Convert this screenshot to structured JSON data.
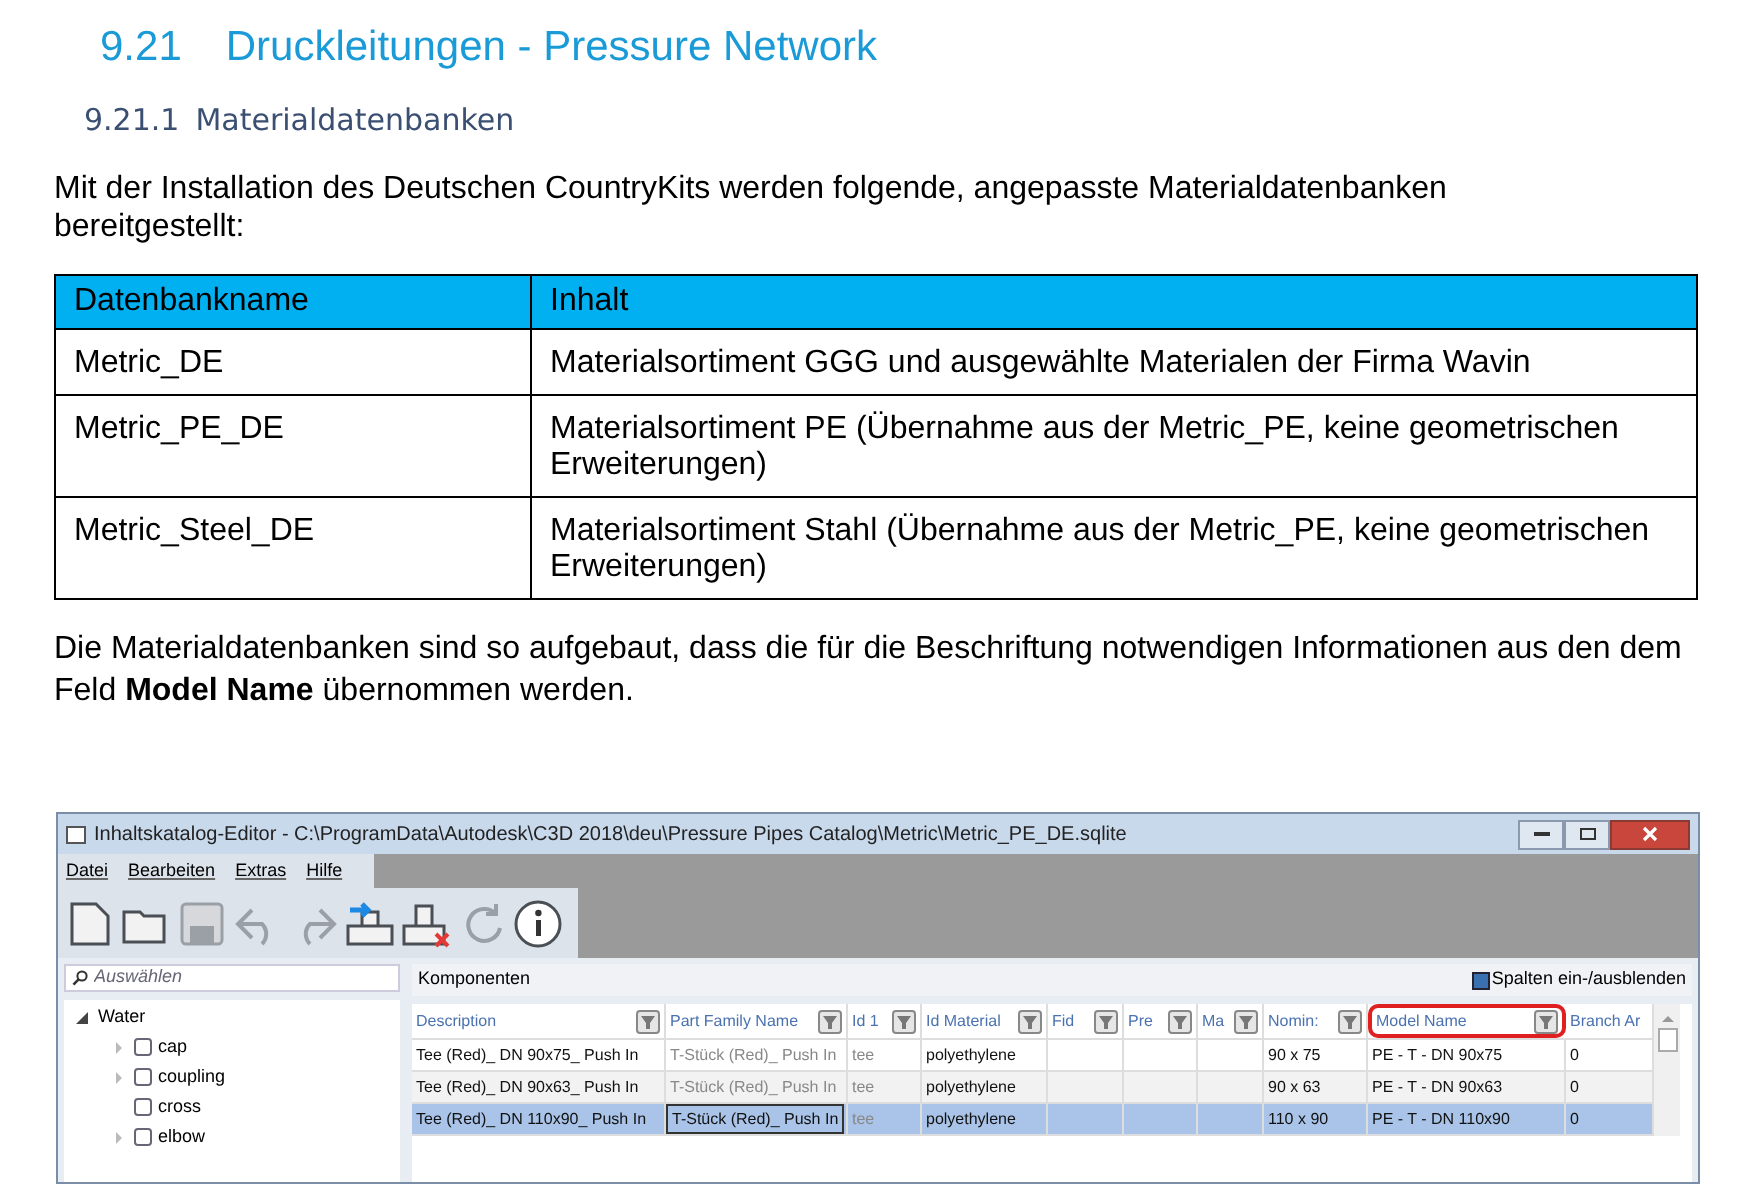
{
  "heading": {
    "number": "9.21",
    "title": "Druckleitungen - Pressure Network"
  },
  "subheading": {
    "number": "9.21.1",
    "title": "Materialdatenbanken"
  },
  "intro": "Mit der Installation des Deutschen CountryKits werden folgende, angepasste Materialdatenbanken bereitgestellt:",
  "table": {
    "columns": [
      "Datenbankname",
      "Inhalt"
    ],
    "rows": [
      [
        "Metric_DE",
        "Materialsortiment GGG und ausgewählte Materialen der Firma Wavin"
      ],
      [
        "Metric_PE_DE",
        "Materialsortiment PE (Übernahme aus der Metric_PE, keine geometrischen Erweiterungen)"
      ],
      [
        "Metric_Steel_DE",
        "Materialsortiment Stahl (Übernahme aus der Metric_PE, keine geometrischen Erweiterungen)"
      ]
    ]
  },
  "note": "Die Materialdatenbanken sind so aufgebaut, dass die für die Beschriftung notwendigen Informationen aus den dem Feld **Model Name** übernommen werden.",
  "app_window": {
    "title": "Inhaltskatalog-Editor - C:\\ProgramData\\Autodesk\\C3D 2018\\deu\\Pressure Pipes Catalog\\Metric\\Metric_PE_DE.sqlite",
    "menu": [
      "Datei",
      "Bearbeiten",
      "Extras",
      "Hilfe"
    ],
    "toolbar": [
      {
        "kind": "new",
        "disabled": false
      },
      {
        "kind": "open",
        "disabled": false
      },
      {
        "kind": "save",
        "disabled": true
      },
      {
        "kind": "undo",
        "disabled": true
      },
      {
        "kind": "redo",
        "disabled": true
      },
      {
        "kind": "add_part",
        "disabled": false
      },
      {
        "kind": "delete_part",
        "disabled": false
      },
      {
        "kind": "refresh",
        "disabled": true
      },
      {
        "kind": "info",
        "disabled": false
      }
    ],
    "search": {
      "placeholder": "Auswählen"
    },
    "tree": [
      {
        "label": "Water",
        "expanded": true,
        "children": [
          {
            "label": "cap",
            "expandable": true,
            "checked": false
          },
          {
            "label": "coupling",
            "expandable": true,
            "checked": false
          },
          {
            "label": "cross",
            "expandable": false,
            "checked": false
          },
          {
            "label": "elbow",
            "expandable": true,
            "checked": false
          }
        ]
      }
    ],
    "panel_title": "Komponenten",
    "columns_toggle": "Spalten ein-/ausblenden",
    "grid": {
      "columns": [
        {
          "label": "Description",
          "muted": false,
          "highlighted": false
        },
        {
          "label": "Part Family Name",
          "muted": true,
          "highlighted": false
        },
        {
          "label": "Id 1",
          "muted": true,
          "highlighted": false
        },
        {
          "label": "Id Material",
          "muted": false,
          "highlighted": false
        },
        {
          "label": "Fid",
          "highlighted": false
        },
        {
          "label": "Pre",
          "highlighted": false
        },
        {
          "label": "Ma",
          "highlighted": false
        },
        {
          "label": "Nomin:",
          "muted": false,
          "highlighted": false
        },
        {
          "label": "Model Name",
          "muted": false,
          "highlighted": true
        },
        {
          "label": "Branch Ar",
          "muted": false,
          "highlighted": false,
          "filter": false
        }
      ],
      "rows": [
        {
          "selected": false,
          "cells": [
            {
              "text": "Tee (Red)_ DN 90x75_ Push In",
              "focused": false
            },
            {
              "text": "T-Stück (Red)_ Push In",
              "focused": false
            },
            {
              "text": "tee",
              "focused": false
            },
            {
              "text": "polyethylene",
              "focused": false
            },
            null,
            null,
            null,
            {
              "text": "90 x 75",
              "focused": false
            },
            {
              "text": "PE - T - DN 90x75",
              "focused": false
            },
            {
              "text": "0",
              "focused": false
            }
          ]
        },
        {
          "selected": false,
          "cells": [
            {
              "text": "Tee (Red)_ DN 90x63_ Push In",
              "focused": false
            },
            {
              "text": "T-Stück (Red)_ Push In",
              "focused": false
            },
            {
              "text": "tee",
              "focused": false
            },
            {
              "text": "polyethylene",
              "focused": false
            },
            null,
            null,
            null,
            {
              "text": "90 x 63",
              "focused": false
            },
            {
              "text": "PE - T - DN 90x63",
              "focused": false
            },
            {
              "text": "0",
              "focused": false
            }
          ]
        },
        {
          "selected": true,
          "cells": [
            {
              "text": "Tee (Red)_ DN 110x90_ Push In",
              "focused": false
            },
            {
              "text": "T-Stück (Red)_ Push In",
              "focused": true
            },
            {
              "text": "tee",
              "focused": false
            },
            {
              "text": "polyethylene",
              "focused": false
            },
            null,
            null,
            null,
            {
              "text": "110 x 90",
              "focused": false
            },
            {
              "text": "PE - T - DN 110x90",
              "focused": false
            },
            {
              "text": "0",
              "focused": false
            }
          ]
        }
      ]
    }
  }
}
